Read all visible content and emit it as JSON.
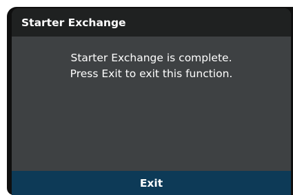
{
  "dialog": {
    "title": "Starter Exchange",
    "message": {
      "line1": "Starter Exchange is complete.",
      "line2": "Press Exit to exit this function."
    },
    "exit_label": "Exit"
  },
  "colors": {
    "header_bg": "#1f2121",
    "body_bg": "#3e4143",
    "footer_bg": "#0d3a57",
    "text": "#ffffff"
  }
}
